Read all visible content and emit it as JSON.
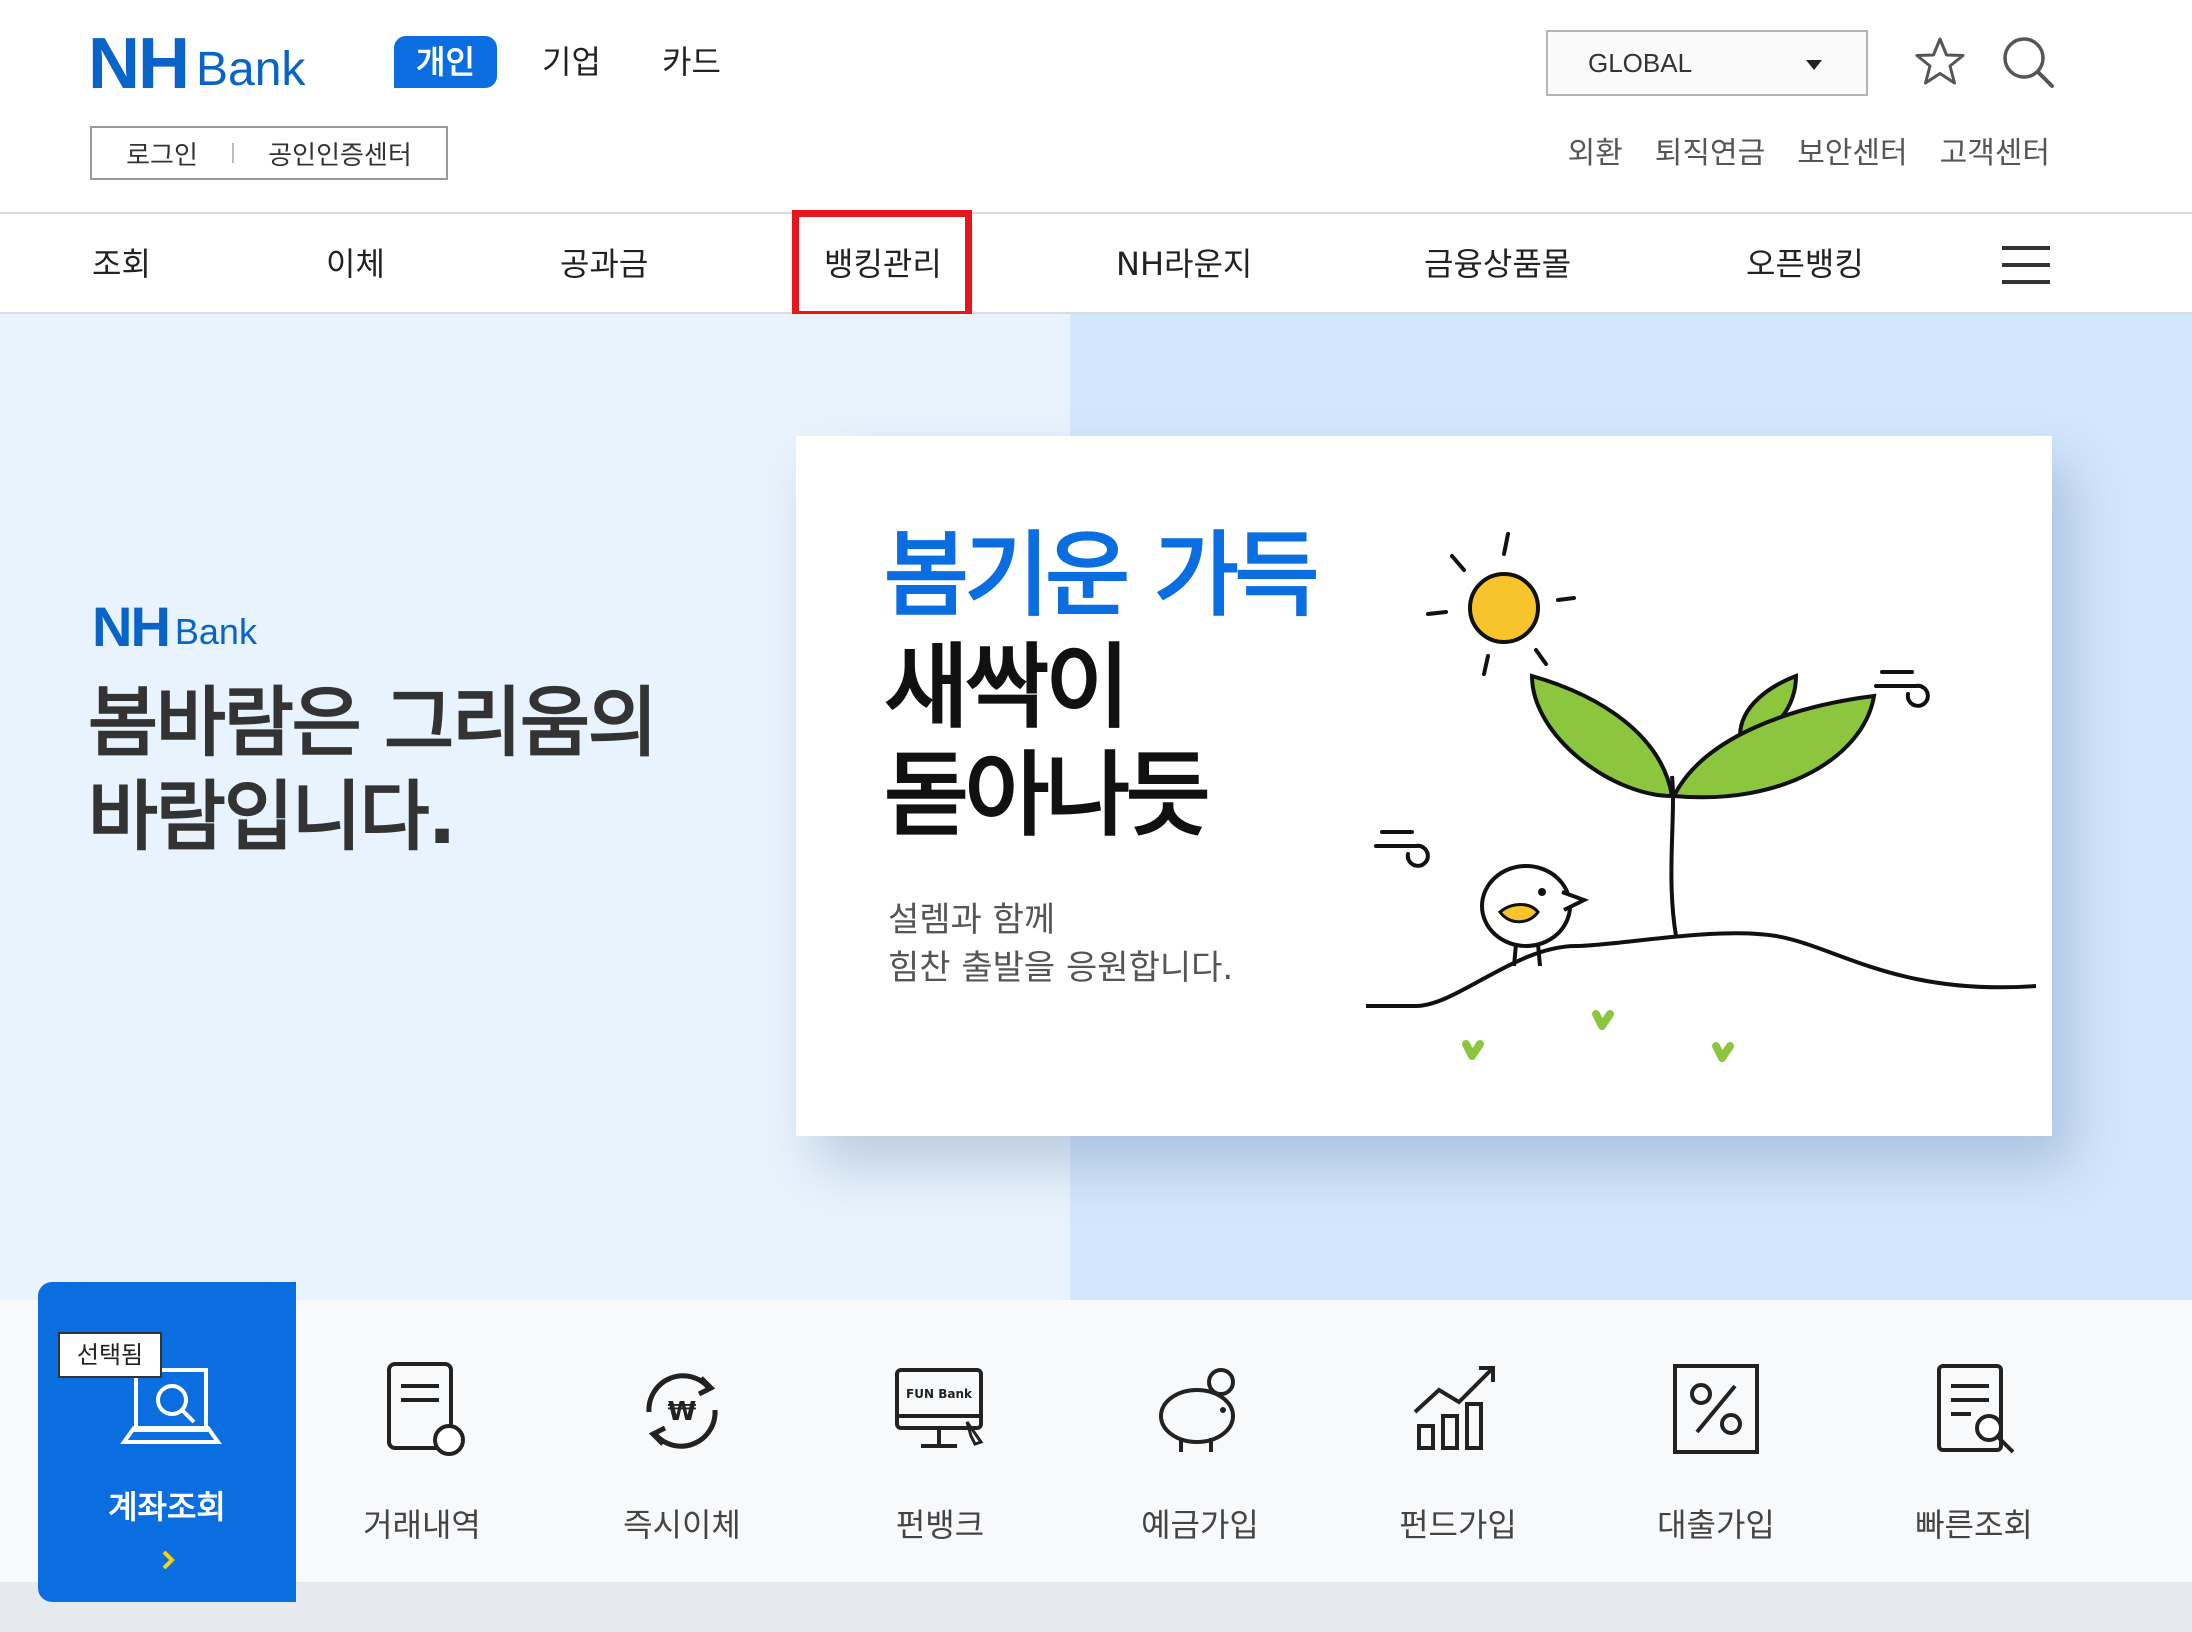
{
  "header": {
    "logo_nh": "NH",
    "logo_bank": "Bank",
    "segments": [
      "개인",
      "기업",
      "카드"
    ],
    "auth": {
      "login": "로그인",
      "cert_center": "공인인증센터"
    },
    "global_select": "GLOBAL",
    "util_links": [
      "외환",
      "퇴직연금",
      "보안센터",
      "고객센터"
    ]
  },
  "gnb": {
    "items": [
      "조회",
      "이체",
      "공과금",
      "뱅킹관리",
      "NH라운지",
      "금융상품몰",
      "오픈뱅킹"
    ],
    "highlighted": "뱅킹관리"
  },
  "hero": {
    "logo_nh": "NH",
    "logo_bank": "Bank",
    "title_line1": "봄바람은 그리움의",
    "title_line2": "바람입니다.",
    "banner": {
      "headline_blue": "봄기운 가득",
      "headline_black_1": "새싹이",
      "headline_black_2": "돋아나듯",
      "sub_1": "설렘과 함께",
      "sub_2": "힘찬 출발을 응원합니다."
    }
  },
  "quick_menu": {
    "selected_tag": "선택됨",
    "items": [
      "계좌조회",
      "거래내역",
      "즉시이체",
      "펀뱅크",
      "예금가입",
      "펀드가입",
      "대출가입",
      "빠른조회"
    ],
    "funbank_icon_text": "FUN Bank"
  },
  "colors": {
    "brand_blue": "#0a6ee0",
    "highlight_red": "#e8161c",
    "hero_left": "#e8f3fd",
    "hero_right": "#d3e6fb"
  }
}
